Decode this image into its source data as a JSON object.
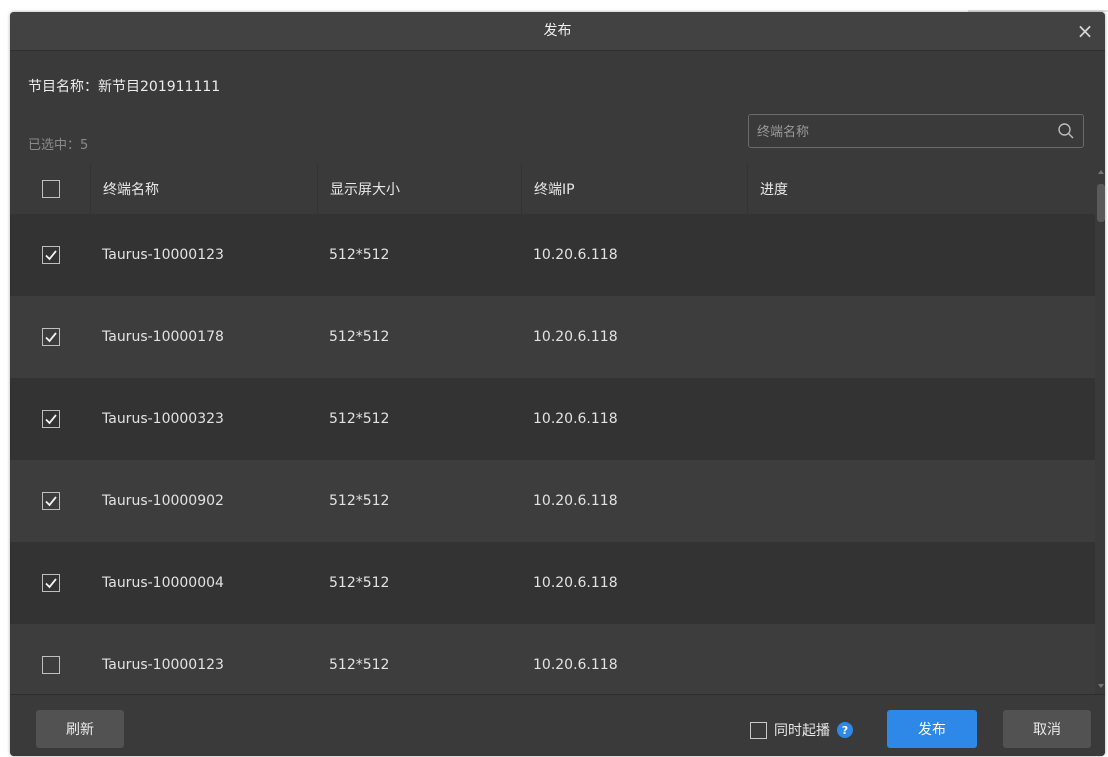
{
  "dialog": {
    "title": "发布",
    "close_glyph": "×",
    "program_name": "节目名称：新节目201911111",
    "selected_count": "已选中：5",
    "search": {
      "placeholder": "终端名称",
      "icon": "search-icon"
    }
  },
  "table": {
    "headers": [
      "终端名称",
      "显示屏大小",
      "终端IP",
      "进度"
    ],
    "rows": [
      {
        "checked": true,
        "name": "Taurus-10000123",
        "size": "512*512",
        "ip": "10.20.6.118",
        "progress": ""
      },
      {
        "checked": true,
        "name": "Taurus-10000178",
        "size": "512*512",
        "ip": "10.20.6.118",
        "progress": ""
      },
      {
        "checked": true,
        "name": "Taurus-10000323",
        "size": "512*512",
        "ip": "10.20.6.118",
        "progress": ""
      },
      {
        "checked": true,
        "name": "Taurus-10000902",
        "size": "512*512",
        "ip": "10.20.6.118",
        "progress": ""
      },
      {
        "checked": true,
        "name": "Taurus-10000004",
        "size": "512*512",
        "ip": "10.20.6.118",
        "progress": ""
      },
      {
        "checked": false,
        "name": "Taurus-10000123",
        "size": "512*512",
        "ip": "10.20.6.118",
        "progress": ""
      }
    ]
  },
  "footer": {
    "refresh_label": "刷新",
    "sync_play_label": "同时起播",
    "sync_play_checked": false,
    "help_glyph": "?",
    "publish_label": "发布",
    "cancel_label": "取消"
  },
  "colors": {
    "dialog_bg": "#3a3a3a",
    "row_dark": "#333333",
    "row_light": "#3d3d3d",
    "accent": "#2d88e8"
  }
}
